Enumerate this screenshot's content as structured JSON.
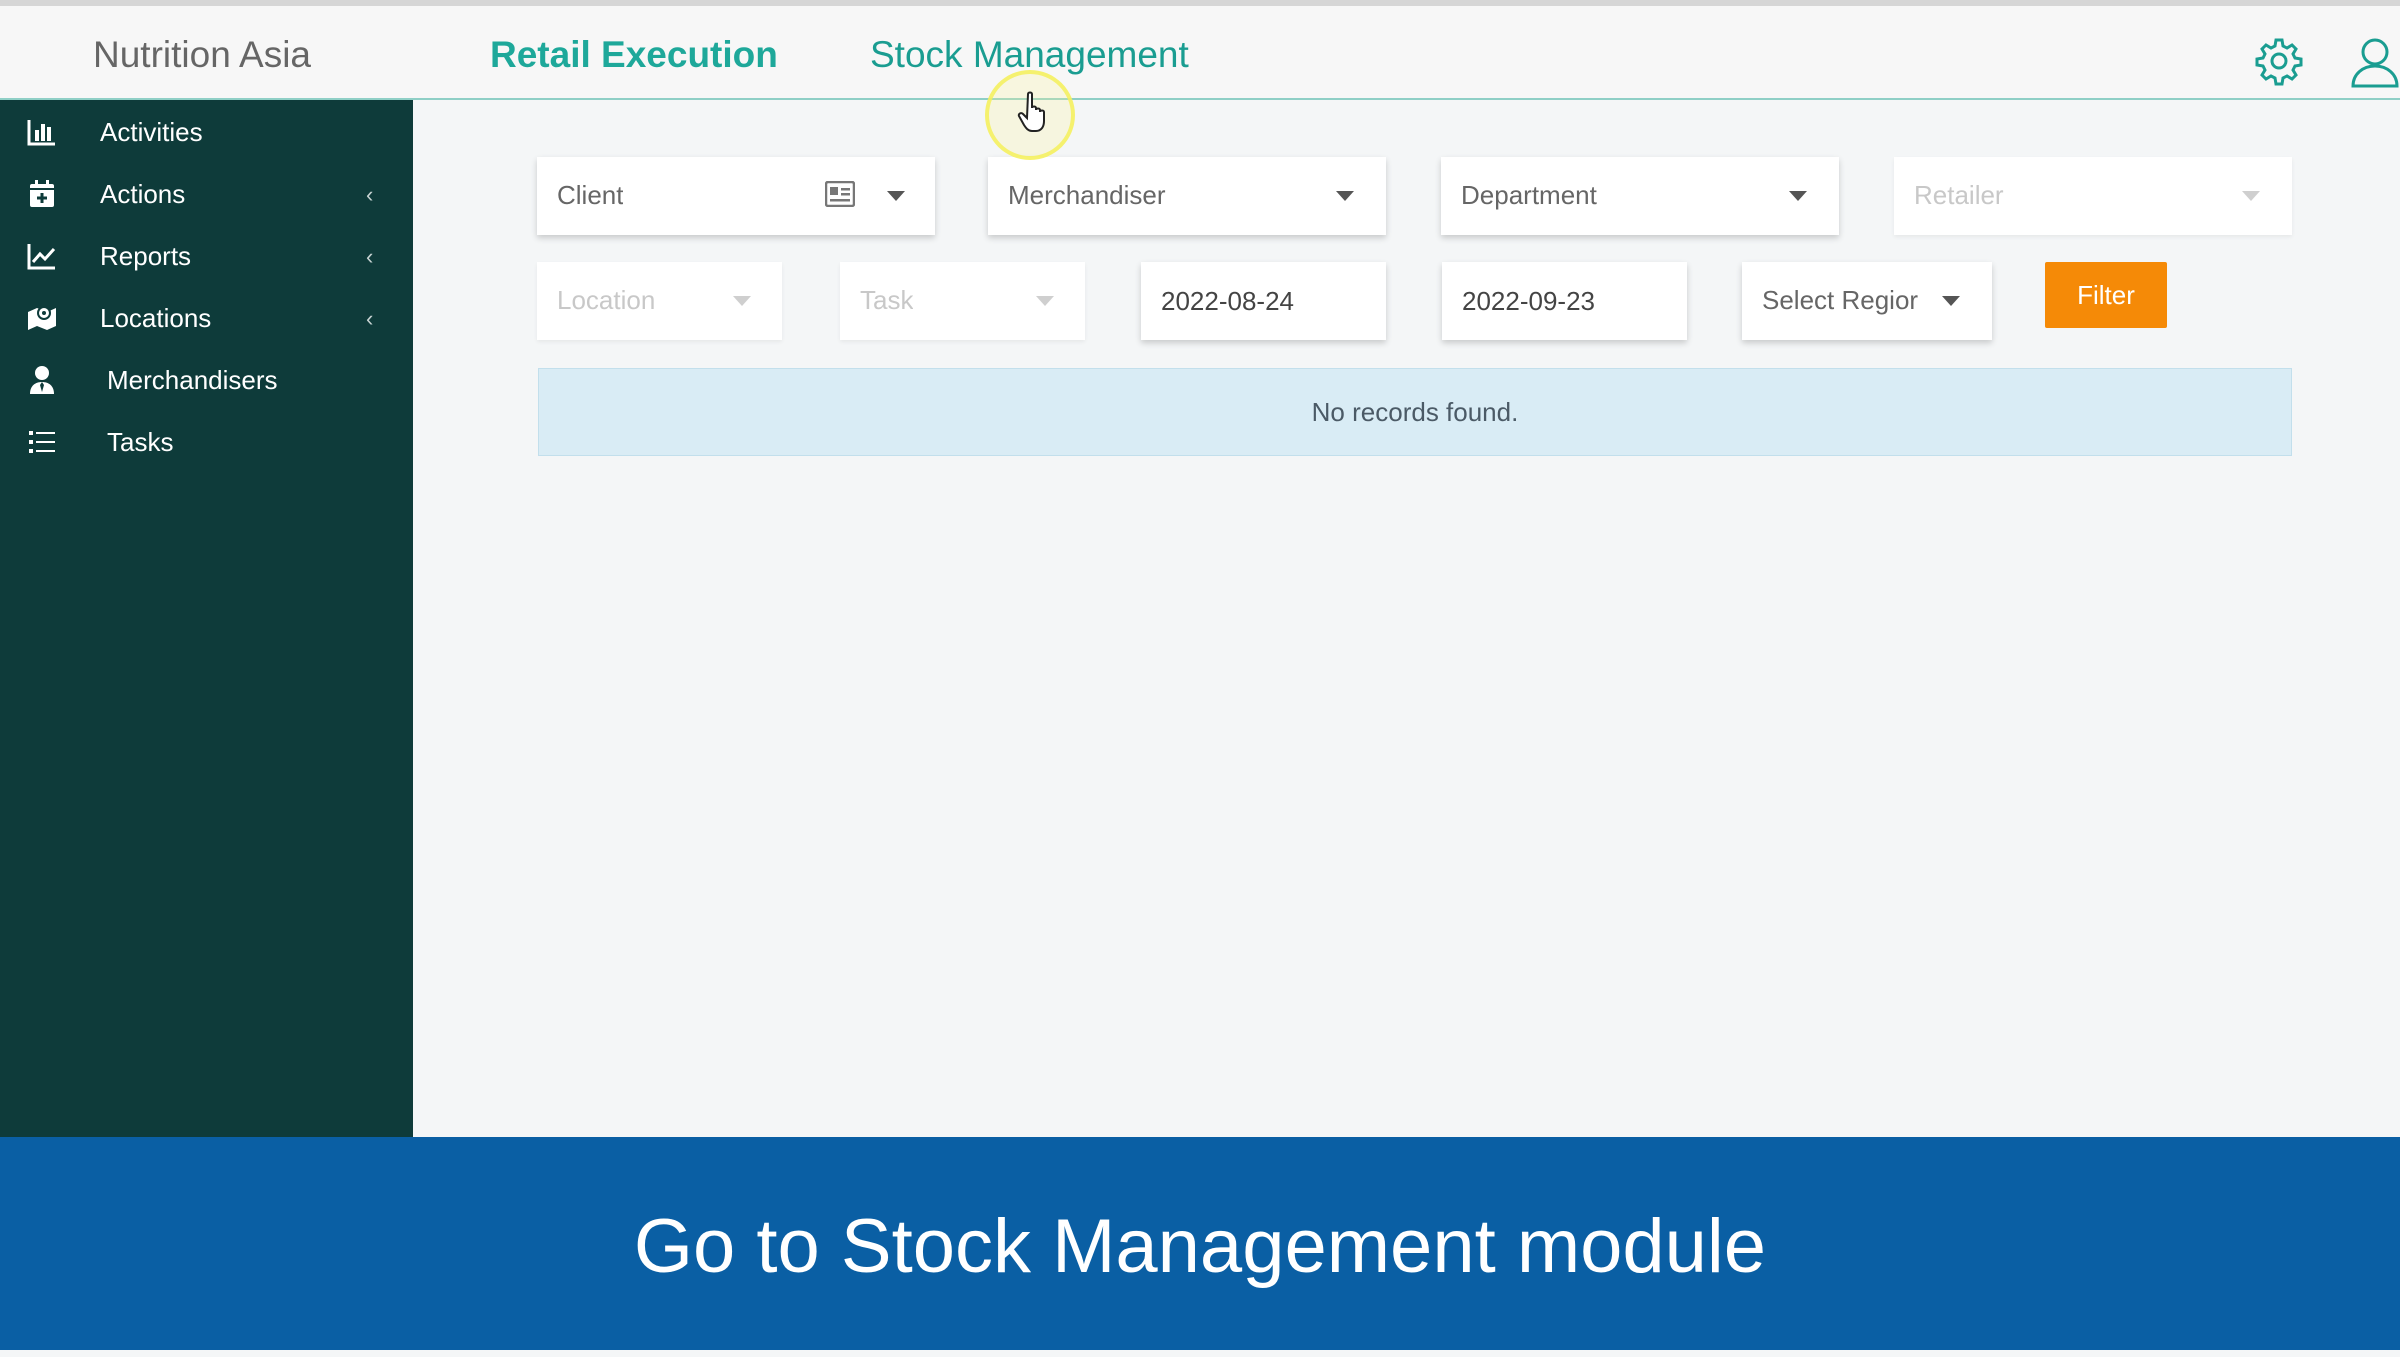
{
  "header": {
    "brand": "Nutrition Asia",
    "tabs": [
      {
        "label": "Retail Execution",
        "active": true
      },
      {
        "label": "Stock Management",
        "active": false
      }
    ],
    "icons": [
      "gear-icon",
      "user-icon"
    ],
    "accent": "#1ea89a"
  },
  "sidebar": {
    "background": "#0e3b3a",
    "items": [
      {
        "label": "Activities",
        "icon": "bar-chart-icon",
        "has_submenu": false
      },
      {
        "label": "Actions",
        "icon": "calendar-plus-icon",
        "has_submenu": true
      },
      {
        "label": "Reports",
        "icon": "line-chart-icon",
        "has_submenu": true
      },
      {
        "label": "Locations",
        "icon": "map-icon",
        "has_submenu": true
      },
      {
        "label": "Merchandisers",
        "icon": "user-tie-icon",
        "has_submenu": false
      },
      {
        "label": "Tasks",
        "icon": "list-icon",
        "has_submenu": false
      }
    ],
    "chevron": "‹"
  },
  "filters": {
    "client": "Client",
    "merchandiser": "Merchandiser",
    "department": "Department",
    "retailer": "Retailer",
    "location": "Location",
    "task": "Task",
    "date_from": "2022-08-24",
    "date_to": "2022-09-23",
    "region": "Select Regior",
    "filter_button": "Filter",
    "filter_color": "#f58a07"
  },
  "results": {
    "message": "No records found."
  },
  "caption": {
    "text": "Go to Stock Management module",
    "background": "#0a5fa4"
  }
}
